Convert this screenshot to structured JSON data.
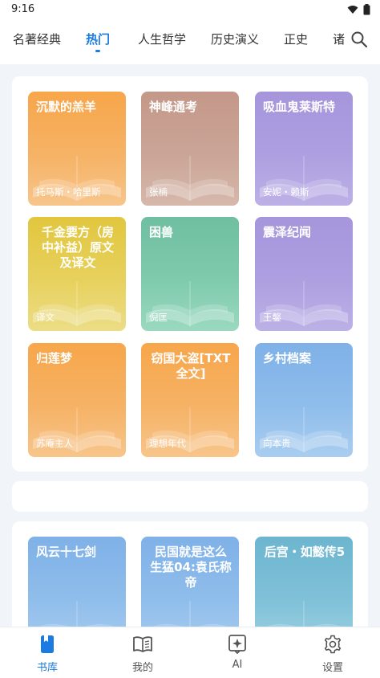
{
  "status_bar": {
    "time": "9:16"
  },
  "tabs": [
    {
      "label": "名著经典",
      "active": false
    },
    {
      "label": "热门",
      "active": true
    },
    {
      "label": "人生哲学",
      "active": false
    },
    {
      "label": "历史演义",
      "active": false
    },
    {
      "label": "正史",
      "active": false
    },
    {
      "label": "诸",
      "active": false
    }
  ],
  "books": [
    {
      "title": "沉默的羔羊",
      "author": "托马斯・哈里斯",
      "color": "orange"
    },
    {
      "title": "神峰通考",
      "author": "张楠",
      "color": "brown"
    },
    {
      "title": "吸血鬼莱斯特",
      "author": "安妮・赖斯",
      "color": "purple"
    },
    {
      "title": "千金要方（房中补益）原文及译文",
      "author": "译文",
      "color": "yellow"
    },
    {
      "title": "困兽",
      "author": "倪匡",
      "color": "green"
    },
    {
      "title": "震泽纪闻",
      "author": "王鏊",
      "color": "purple"
    },
    {
      "title": "归莲梦",
      "author": "苏庵主人",
      "color": "orange"
    },
    {
      "title": "窃国大盗[TXT全文]",
      "author": "理想年代",
      "color": "orange"
    },
    {
      "title": "乡村档案",
      "author": "向本贵",
      "color": "blue"
    }
  ],
  "books_second": [
    {
      "title": "风云十七剑",
      "color": "blue"
    },
    {
      "title": "民国就是这么生猛04:袁氏称帝",
      "color": "blue"
    },
    {
      "title": "后宫・如懿传5",
      "color": "teal"
    }
  ],
  "bottom_nav": [
    {
      "label": "书库",
      "icon": "book-icon",
      "active": true
    },
    {
      "label": "我的",
      "icon": "open-book-icon",
      "active": false
    },
    {
      "label": "AI",
      "icon": "ai-sparkle-icon",
      "active": false
    },
    {
      "label": "设置",
      "icon": "gear-icon",
      "active": false
    }
  ],
  "colors": {
    "accent": "#1b7be0",
    "background": "#f1f4f8"
  }
}
